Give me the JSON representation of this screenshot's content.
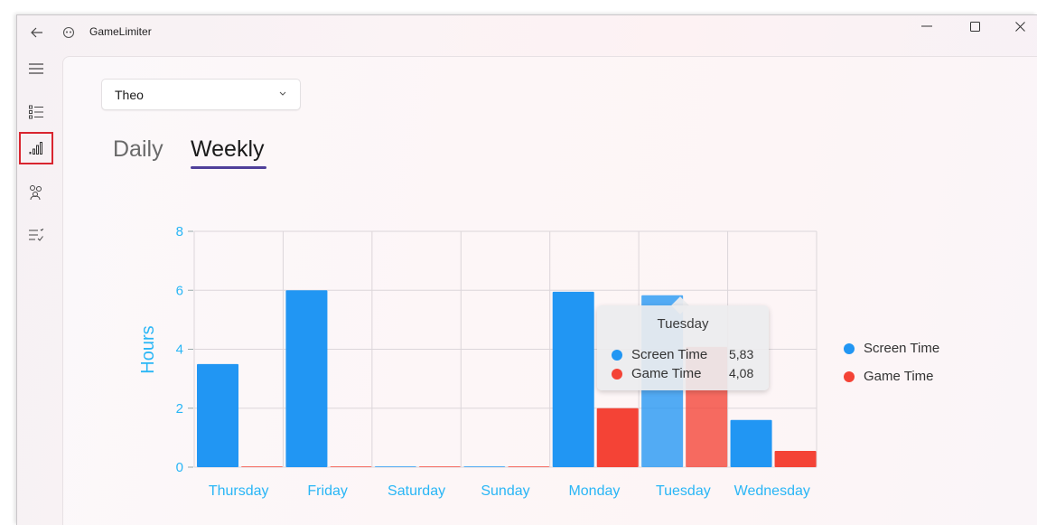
{
  "app": {
    "title": "GameLimiter"
  },
  "nav": {
    "items": [
      {
        "name": "menu-icon"
      },
      {
        "name": "list-icon"
      },
      {
        "name": "statistics-icon",
        "selected": true
      },
      {
        "name": "people-icon"
      },
      {
        "name": "checklist-icon"
      }
    ]
  },
  "user_select": {
    "value": "Theo"
  },
  "tabs": {
    "daily": "Daily",
    "weekly": "Weekly",
    "selected": "weekly"
  },
  "colors": {
    "screen_time": "#2196f3",
    "game_time": "#f44336",
    "axis_text": "#29b6f6",
    "accent": "#4f3f9a",
    "nav_highlight": "#d9252f"
  },
  "legend": {
    "screen_time": "Screen Time",
    "game_time": "Game Time"
  },
  "tooltip": {
    "title": "Tuesday",
    "rows": [
      {
        "label": "Screen Time",
        "value": "5,83"
      },
      {
        "label": "Game Time",
        "value": "4,08"
      }
    ]
  },
  "chart_data": {
    "type": "bar",
    "ylabel": "Hours",
    "ylim": [
      0,
      8
    ],
    "yticks": [
      "0",
      "2",
      "4",
      "6",
      "8"
    ],
    "categories": [
      "Thursday",
      "Friday",
      "Saturday",
      "Sunday",
      "Monday",
      "Tuesday",
      "Wednesday"
    ],
    "series": [
      {
        "name": "Screen Time",
        "values": [
          3.5,
          6.0,
          0,
          0,
          5.95,
          5.83,
          1.6
        ]
      },
      {
        "name": "Game Time",
        "values": [
          0,
          0,
          0,
          0,
          2.0,
          4.08,
          0.55
        ]
      }
    ],
    "highlighted_category": "Tuesday",
    "grid": true,
    "legend_position": "right"
  }
}
